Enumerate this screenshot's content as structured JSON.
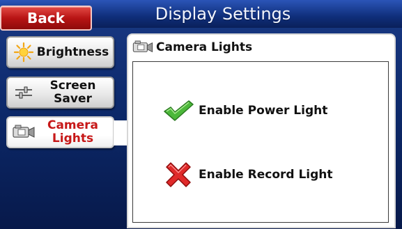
{
  "header": {
    "title": "Display Settings",
    "back_label": "Back"
  },
  "sidebar": {
    "items": [
      {
        "label_line1": "Brightness",
        "label_line2": "",
        "icon": "sun-icon",
        "active": false
      },
      {
        "label_line1": "Screen",
        "label_line2": "Saver",
        "icon": "slider-icon",
        "active": false
      },
      {
        "label_line1": "Camera",
        "label_line2": "Lights",
        "icon": "camera-icon",
        "active": true
      }
    ]
  },
  "panel": {
    "title": "Camera Lights",
    "options": [
      {
        "label": "Enable Power Light",
        "state": "enabled",
        "icon": "check-icon"
      },
      {
        "label": "Enable Record Light",
        "state": "disabled",
        "icon": "x-icon"
      }
    ]
  },
  "colors": {
    "back_button": "#b81414",
    "active_label": "#c71818",
    "check": "#3ea52e",
    "cross": "#d42020",
    "background": "#0d2a6c"
  }
}
